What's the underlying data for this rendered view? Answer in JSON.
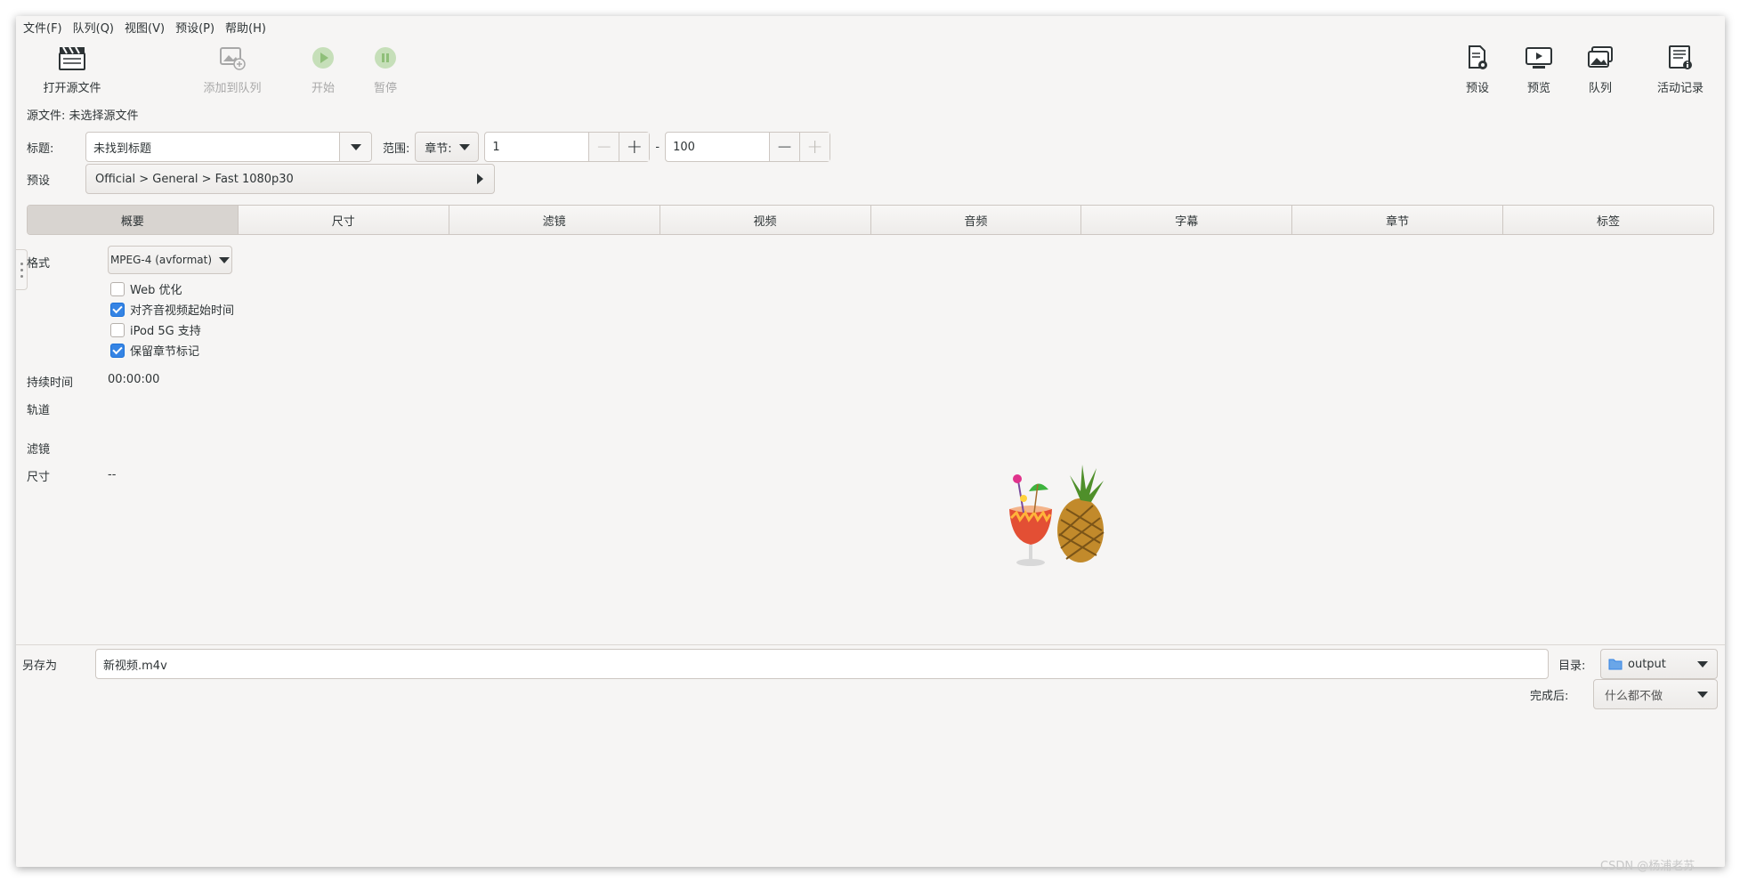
{
  "menu": [
    "文件(F)",
    "队列(Q)",
    "视图(V)",
    "预设(P)",
    "帮助(H)"
  ],
  "toolbar": {
    "open_source": "打开源文件",
    "add_queue": "添加到队列",
    "start": "开始",
    "pause": "暂停",
    "presets": "预设",
    "preview": "预览",
    "queue": "队列",
    "activity": "活动记录"
  },
  "source": {
    "label": "源文件:",
    "value": "未选择源文件"
  },
  "title_row": {
    "label": "标题:",
    "value": "未找到标题",
    "range_label": "范围:",
    "range_mode": "章节:",
    "start": "1",
    "separator": "-",
    "end": "100"
  },
  "preset_row": {
    "label": "预设",
    "value": "Official > General > Fast 1080p30"
  },
  "tabs": [
    "概要",
    "尺寸",
    "滤镜",
    "视频",
    "音频",
    "字幕",
    "章节",
    "标签"
  ],
  "summary": {
    "format_label": "格式",
    "format_value": "MPEG-4 (avformat)",
    "options": [
      {
        "label": "Web 优化",
        "checked": false
      },
      {
        "label": "对齐音视频起始时间",
        "checked": true
      },
      {
        "label": "iPod 5G 支持",
        "checked": false
      },
      {
        "label": "保留章节标记",
        "checked": true
      }
    ],
    "duration_label": "持续时间",
    "duration_value": "00:00:00",
    "tracks_label": "轨道",
    "filters_label": "滤镜",
    "size_label": "尺寸",
    "size_value": "--"
  },
  "bottom": {
    "save_as_label": "另存为",
    "save_as_value": "新视频.m4v",
    "folder_label": "目录:",
    "folder_value": "output",
    "when_done_label": "完成后:",
    "when_done_value": "什么都不做"
  },
  "watermark": "CSDN @杨浦老苏"
}
